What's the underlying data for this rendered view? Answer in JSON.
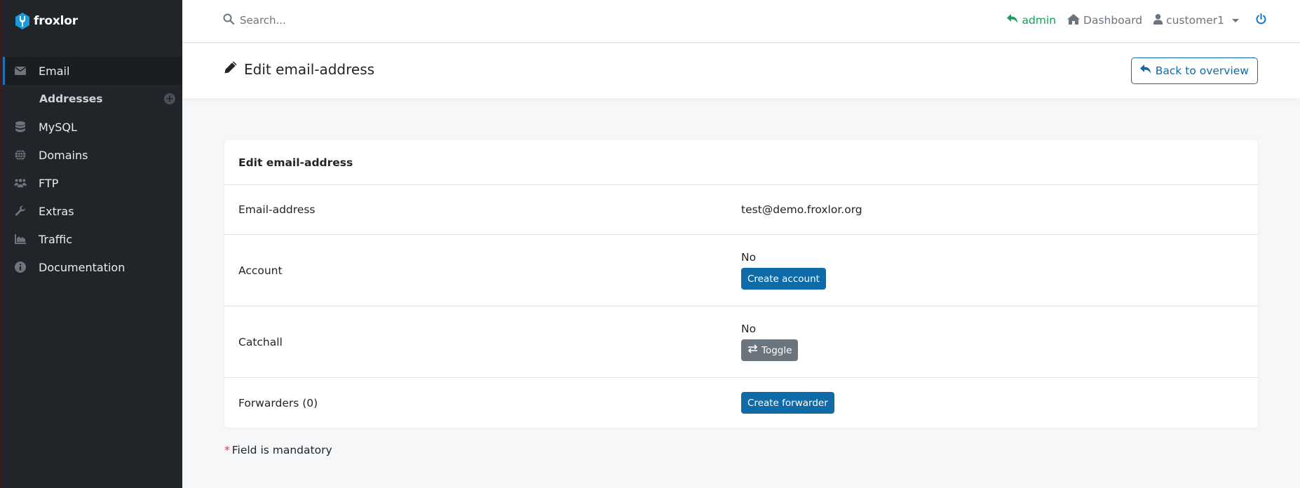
{
  "brand": {
    "name": "froxlor"
  },
  "sidebar": {
    "items": [
      {
        "label": "Email",
        "icon": "envelope-icon",
        "active": true
      },
      {
        "label": "MySQL",
        "icon": "database-icon"
      },
      {
        "label": "Domains",
        "icon": "globe-icon"
      },
      {
        "label": "FTP",
        "icon": "users-icon"
      },
      {
        "label": "Extras",
        "icon": "wrench-icon"
      },
      {
        "label": "Traffic",
        "icon": "area-chart-icon"
      },
      {
        "label": "Documentation",
        "icon": "info-circle-icon"
      }
    ],
    "subitems": [
      {
        "label": "Addresses",
        "action_icon": "plus-circle-icon"
      }
    ]
  },
  "topbar": {
    "search_placeholder": "Search...",
    "admin_label": "admin",
    "dashboard_label": "Dashboard",
    "user_label": "customer1"
  },
  "page": {
    "title": "Edit email-address",
    "back_label": "Back to overview"
  },
  "card": {
    "title": "Edit email-address",
    "rows": [
      {
        "label": "Email-address",
        "value": "test@demo.froxlor.org"
      },
      {
        "label": "Account",
        "value": "No",
        "button": "Create account"
      },
      {
        "label": "Catchall",
        "value": "No",
        "button": "Toggle"
      },
      {
        "label": "Forwarders (0)",
        "button": "Create forwarder"
      }
    ]
  },
  "footer": {
    "mandatory_star": "*",
    "mandatory_text": "Field is mandatory"
  },
  "colors": {
    "primary": "#0e6ba8",
    "secondary": "#6c757d",
    "sidebar": "#212529",
    "admin": "#12a05c",
    "danger": "#dc3545"
  }
}
